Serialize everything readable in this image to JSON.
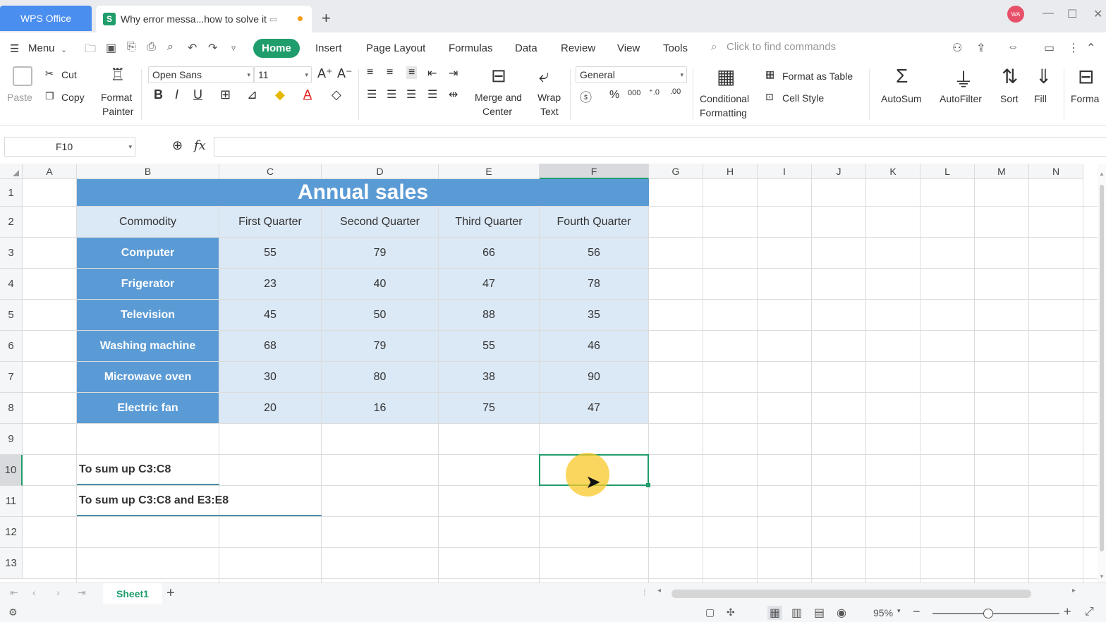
{
  "titlebar": {
    "app_tab": "WPS Office",
    "doc_tab": "Why error messa...how to solve it",
    "new_tab": "+",
    "avatar": "WA",
    "minimize": "—",
    "maximize": "☐",
    "close": "✕"
  },
  "menu": {
    "menu_label": "Menu",
    "tabs": [
      "Home",
      "Insert",
      "Page Layout",
      "Formulas",
      "Data",
      "Review",
      "View",
      "Tools"
    ],
    "search_placeholder": "Click to find commands"
  },
  "ribbon": {
    "paste": "Paste",
    "cut": "Cut",
    "copy": "Copy",
    "format_painter_1": "Format",
    "format_painter_2": "Painter",
    "font_name": "Open Sans",
    "font_size": "11",
    "merge_1": "Merge and",
    "merge_2": "Center",
    "wrap_1": "Wrap",
    "wrap_2": "Text",
    "number_format": "General",
    "cond_1": "Conditional",
    "cond_2": "Formatting",
    "format_table": "Format as Table",
    "cell_style": "Cell Style",
    "autosum": "AutoSum",
    "autofilter": "AutoFilter",
    "sort": "Sort",
    "fill": "Fill",
    "format": "Forma"
  },
  "formula_bar": {
    "cell_ref": "F10",
    "fx": "fx",
    "value": ""
  },
  "sheet": {
    "columns": [
      "A",
      "B",
      "C",
      "D",
      "E",
      "F",
      "G",
      "H",
      "I",
      "J",
      "K",
      "L",
      "M",
      "N"
    ],
    "rows": [
      "1",
      "2",
      "3",
      "4",
      "5",
      "6",
      "7",
      "8",
      "9",
      "10",
      "11",
      "12",
      "13"
    ],
    "title": "Annual sales",
    "headers": [
      "Commodity",
      "First Quarter",
      "Second Quarter",
      "Third Quarter",
      "Fourth Quarter"
    ],
    "data": [
      {
        "name": "Computer",
        "q1": "55",
        "q2": "79",
        "q3": "66",
        "q4": "56"
      },
      {
        "name": "Frigerator",
        "q1": "23",
        "q2": "40",
        "q3": "47",
        "q4": "78"
      },
      {
        "name": "Television",
        "q1": "45",
        "q2": "50",
        "q3": "88",
        "q4": "35"
      },
      {
        "name": "Washing machine",
        "q1": "68",
        "q2": "79",
        "q3": "55",
        "q4": "46"
      },
      {
        "name": "Microwave oven",
        "q1": "30",
        "q2": "80",
        "q3": "38",
        "q4": "90"
      },
      {
        "name": "Electric fan",
        "q1": "20",
        "q2": "16",
        "q3": "75",
        "q4": "47"
      }
    ],
    "note1": "To sum up C3:C8",
    "note2": "To sum up C3:C8 and E3:E8",
    "selected_cell": "F10",
    "colors": {
      "header_blue": "#5b9bd5",
      "light_blue": "#dbe8f5",
      "accent_green": "#1f9d6b"
    }
  },
  "sheetbar": {
    "sheet_name": "Sheet1",
    "add": "+"
  },
  "statusbar": {
    "zoom": "95%"
  }
}
